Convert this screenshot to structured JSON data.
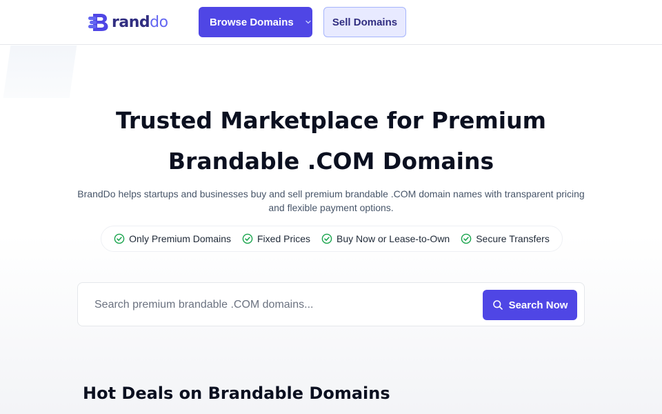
{
  "header": {
    "logo": {
      "icon": "b-logo-mark",
      "text_part1": "rand",
      "text_part2": "do"
    },
    "browse_label": "Browse Domains",
    "browse_icon": "chevron-down-icon",
    "sell_label": "Sell Domains"
  },
  "hero": {
    "title_line1": "Trusted Marketplace for Premium",
    "title_line2": "Brandable .COM Domains",
    "subtitle": "BrandDo helps startups and businesses buy and sell premium brandable .COM domain names with transparent pricing and flexible payment options."
  },
  "features": [
    {
      "icon": "check-circle-icon",
      "label": "Only Premium Domains"
    },
    {
      "icon": "check-circle-icon",
      "label": "Fixed Prices"
    },
    {
      "icon": "check-circle-icon",
      "label": "Buy Now or Lease-to-Own"
    },
    {
      "icon": "check-circle-icon",
      "label": "Secure Transfers"
    }
  ],
  "search": {
    "placeholder": "Search premium brandable .COM domains...",
    "value": "",
    "button_label": "Search Now",
    "button_icon": "search-icon"
  },
  "sections": {
    "hot_deals_title": "Hot Deals on Brandable Domains"
  },
  "colors": {
    "accent": "#4f46e5",
    "accent_light": "#e8eaff",
    "check": "#16a34a",
    "text_dark": "#0b1020",
    "text_muted": "#475569"
  }
}
